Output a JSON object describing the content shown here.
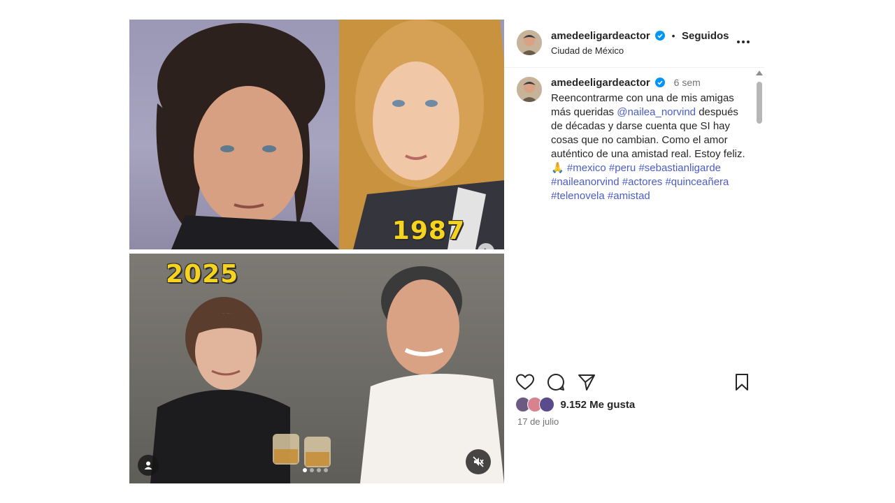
{
  "post": {
    "media": {
      "year_top": "1987",
      "year_bottom": "2025",
      "carousel_dots": 4,
      "active_dot": 0
    },
    "header": {
      "username": "amedeeligardeactor",
      "separator": "•",
      "follow_status": "Seguidos",
      "location": "Ciudad de México",
      "more_icon": "more-horizontal-icon"
    },
    "caption": {
      "username": "amedeeligardeactor",
      "time": "6 sem",
      "text_1": "Reencontrarme con una de mis amigas más queridas ",
      "mention": "@nailea_norvind",
      "text_2": " después de décadas y darse cuenta que SI hay cosas que no cambian. Como el amor auténtico de una amistad real. Estoy feliz. 🙏 ",
      "hashtags": [
        "#mexico",
        "#peru",
        "#sebastianligarde",
        "#naileanorvind",
        "#actores",
        "#quinceañera",
        "#telenovela",
        "#amistad"
      ]
    },
    "actions": {
      "like_icon": "heart-icon",
      "comment_icon": "comment-icon",
      "share_icon": "send-icon",
      "save_icon": "bookmark-icon"
    },
    "likes": "9.152 Me gusta",
    "date": "17 de julio",
    "colors": {
      "verified": "#0095f6",
      "link": "#4a5cc9",
      "year_label": "#f5d31f",
      "secondary_text": "#737373"
    }
  }
}
